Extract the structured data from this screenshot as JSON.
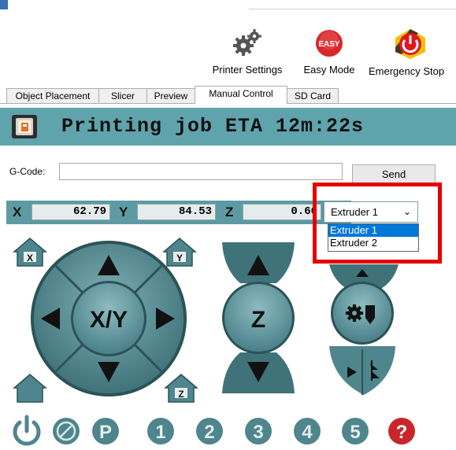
{
  "toolbar": {
    "printer_settings": "Printer Settings",
    "easy_mode": "Easy Mode",
    "easy_badge": "EASY",
    "emergency_stop": "Emergency Stop"
  },
  "tabs": [
    "Object Placement",
    "Slicer",
    "Preview",
    "Manual Control",
    "SD Card"
  ],
  "active_tab": "Manual Control",
  "status": {
    "text": "Printing job ETA 12m:22s"
  },
  "gcode": {
    "label": "G-Code:",
    "value": "",
    "send_label": "Send"
  },
  "coords": {
    "x_label": "X",
    "x_value": "62.79",
    "y_label": "Y",
    "y_value": "84.53",
    "z_label": "Z",
    "z_value": "0.60"
  },
  "extruder": {
    "selected": "Extruder 1",
    "options": [
      "Extruder 1",
      "Extruder 2"
    ],
    "highlighted": "Extruder 1"
  },
  "xy_pad": {
    "center_label": "X/Y"
  },
  "z_pad": {
    "center_label": "Z"
  },
  "home_buttons": {
    "x": "X",
    "y": "Y",
    "z": "Z"
  },
  "bottom_buttons": [
    "1",
    "2",
    "3",
    "4",
    "5"
  ],
  "bottom_p": "P",
  "help_glyph": "?",
  "colors": {
    "banner": "#5fa3ac",
    "control_teal": "#4f858d",
    "control_light": "#6fa3aa",
    "highlight": "#e60000",
    "selection": "#0078d7"
  }
}
